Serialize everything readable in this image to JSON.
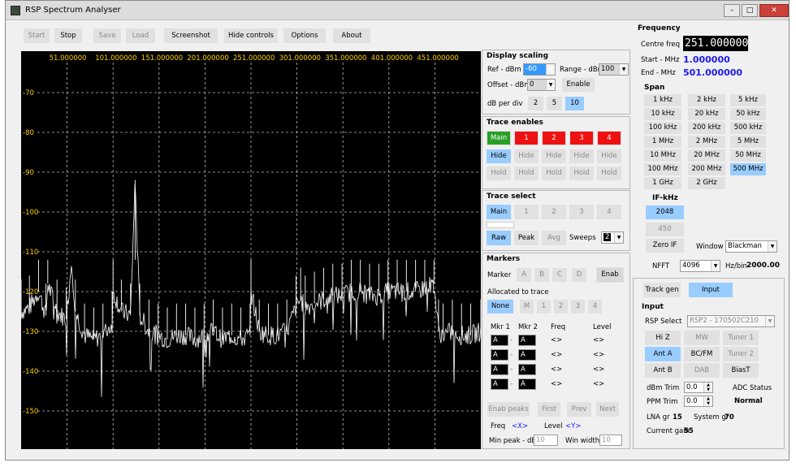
{
  "title": "RSP Spectrum Analyser",
  "window_buttons": [
    "–",
    "□",
    "✕"
  ],
  "toolbar": {
    "start": "Start",
    "stop": "Stop",
    "save": "Save",
    "load": "Load",
    "screenshot": "Screenshot",
    "hide_controls": "Hide controls",
    "options": "Options",
    "about": "About"
  },
  "chart_data": {
    "type": "line",
    "x_ticks": [
      "51.000000",
      "101.000000",
      "151.000000",
      "201.000000",
      "251.000000",
      "301.000000",
      "351.000000",
      "401.000000",
      "451.000000"
    ],
    "y_ticks": [
      "-70",
      "-80",
      "-90",
      "-100",
      "-110",
      "-120",
      "-130",
      "-140",
      "-150"
    ],
    "xlim": [
      1,
      501
    ],
    "ylim": [
      -160,
      -60
    ],
    "grid": true,
    "trace_color": "#ffffff",
    "series": [
      {
        "x": [
          1,
          10,
          20,
          28,
          30,
          40,
          50,
          56,
          60,
          70,
          80,
          90,
          100,
          101,
          110,
          120,
          125,
          130,
          140,
          150,
          160,
          170,
          180,
          190,
          200,
          210,
          220,
          230,
          240,
          250,
          251,
          260,
          270,
          280,
          290,
          300,
          305,
          310,
          320,
          330,
          340,
          350,
          360,
          370,
          380,
          390,
          400,
          410,
          420,
          430,
          440,
          450,
          455,
          460,
          470,
          480,
          490,
          501
        ],
        "y": [
          -125,
          -124,
          -120,
          -126,
          -118,
          -125,
          -127,
          -112,
          -125,
          -131,
          -132,
          -131,
          -128,
          -120,
          -125,
          -126,
          -92,
          -126,
          -130,
          -131,
          -132,
          -131,
          -131,
          -132,
          -131,
          -130,
          -132,
          -131,
          -132,
          -131,
          -120,
          -130,
          -131,
          -131,
          -130,
          -124,
          -122,
          -124,
          -123,
          -122,
          -121,
          -121,
          -120,
          -120,
          -121,
          -121,
          -120,
          -120,
          -120,
          -120,
          -119,
          -118,
          -130,
          -131,
          -130,
          -131,
          -131,
          -130
        ]
      }
    ]
  },
  "display_scaling": {
    "title": "Display scaling",
    "ref_label": "Ref - dBm",
    "ref_value": "-60",
    "range_label": "Range - dBm",
    "range_value": "100",
    "offset_label": "Offset - dBm",
    "offset_value": "0",
    "enable": "Enable",
    "dbdiv_label": "dB per div",
    "dbdiv": [
      "2",
      "5",
      "10"
    ]
  },
  "trace_enables": {
    "title": "Trace enables",
    "traces": [
      "Main",
      "1",
      "2",
      "3",
      "4"
    ],
    "hide": "Hide",
    "hold": "Hold"
  },
  "trace_select": {
    "title": "Trace select",
    "traces": [
      "Main",
      "1",
      "2",
      "3",
      "4"
    ],
    "raw": "Raw",
    "peak": "Peak",
    "avg": "Avg",
    "sweeps_label": "Sweeps",
    "sweeps_value": "2"
  },
  "markers": {
    "title": "Markers",
    "marker_label": "Marker",
    "letters": [
      "A",
      "B",
      "C",
      "D"
    ],
    "enab": "Enab",
    "allocated": "Allocated to trace",
    "alloc": [
      "None",
      "M",
      "1",
      "2",
      "3",
      "4"
    ],
    "hdr_mkr1": "Mkr 1",
    "hdr_mkr2": "Mkr 2",
    "hdr_freq": "Freq",
    "hdr_level": "Level",
    "row_mkr": "A",
    "row_sign": "-",
    "row_val": "<>",
    "enab_peaks": "Enab peaks",
    "first": "First",
    "prev": "Prev",
    "next": "Next",
    "freq_label": "Freq",
    "freq_val": "<X>",
    "level_label": "Level",
    "level_val": "<Y>",
    "minpeak_label": "Min peak - dB",
    "minpeak_val": "10",
    "winwidth_label": "Win width",
    "winwidth_val": "10"
  },
  "frequency": {
    "title": "Frequency",
    "centre_label": "Centre freq",
    "centre_value": "251.000000",
    "start_label": "Start - MHz",
    "start_value": "1.000000",
    "end_label": "End - MHz",
    "end_value": "501.000000"
  },
  "span": {
    "title": "Span",
    "items": [
      "1 kHz",
      "2 kHz",
      "5 kHz",
      "10 kHz",
      "20 kHz",
      "50 kHz",
      "100 kHz",
      "200 kHz",
      "500 kHz",
      "1 MHz",
      "2 MHz",
      "5 MHz",
      "10 MHz",
      "20 MHz",
      "50 MHz",
      "100 MHz",
      "200 MHz",
      "500 MHz",
      "1 GHz",
      "2 GHz"
    ]
  },
  "if": {
    "title": "IF-kHz",
    "items": [
      "2048",
      "450",
      "Zero IF"
    ]
  },
  "window": {
    "label": "Window",
    "value": "Blackman"
  },
  "nfft": {
    "label": "NFFT",
    "value": "4096",
    "hzbin_label": "Hz/bin",
    "hzbin_value": "2000.00"
  },
  "tabs": {
    "track": "Track gen",
    "input": "Input"
  },
  "input": {
    "title": "Input",
    "rsp_label": "RSP Select",
    "rsp_value": "RSP2 - 170502C210",
    "hiz": "Hi Z",
    "mw": "MW",
    "tuner1": "Tuner 1",
    "anta": "Ant A",
    "bcfm": "BC/FM",
    "tuner2": "Tuner 2",
    "antb": "Ant B",
    "dab": "DAB",
    "biast": "BiasT",
    "dbm_trim_label": "dBm Trim",
    "dbm_trim": "0.0",
    "ppm_trim_label": "PPM Trim",
    "ppm_trim": "0.0",
    "adc_label": "ADC Status",
    "adc_value": "Normal",
    "lna_label": "LNA gr",
    "lna_value": "15",
    "sys_label": "System gr",
    "sys_value": "70",
    "gain_label": "Current gain",
    "gain_value": "55"
  }
}
